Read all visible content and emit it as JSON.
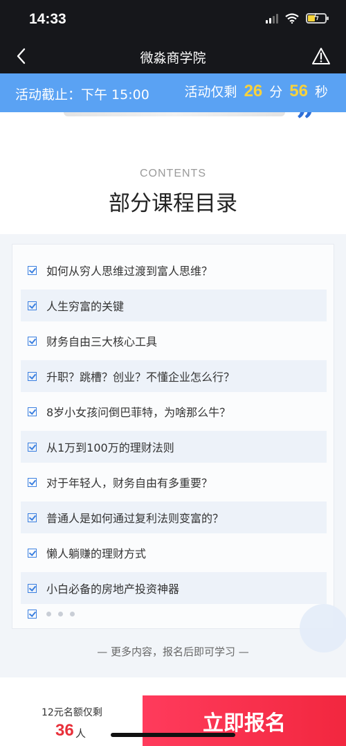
{
  "status_bar": {
    "time": "14:33"
  },
  "nav": {
    "title": "微淼商学院"
  },
  "countdown": {
    "deadline": "活动截止：下午 15:00",
    "remaining_label": "活动仅剩",
    "minutes": "26",
    "minutes_unit": "分",
    "seconds": "56",
    "seconds_unit": "秒"
  },
  "section": {
    "eyebrow": "CONTENTS",
    "title": "部分课程目录"
  },
  "course_items": [
    "如何从穷人思维过渡到富人思维？",
    "人生穷富的关键",
    "财务自由三大核心工具",
    "升职？跳槽？创业？不懂企业怎么行？",
    "8岁小女孩问倒巴菲特，为啥那么牛？",
    "从1万到100万的理财法则",
    "对于年轻人，财务自由有多重要？",
    "普通人是如何通过复利法则变富的？",
    "懒人躺赚的理财方式",
    "小白必备的房地产投资神器"
  ],
  "more_text": "— 更多内容，报名后即可学习 —",
  "bottom": {
    "slots_label": "12元名额仅剩",
    "slots_count": "36",
    "slots_unit": "人",
    "signup_label": "立即报名"
  },
  "colors": {
    "topbar": "#16171b",
    "countdown_bg": "#5aa2f3",
    "countdown_digits": "#f8d23c",
    "accent_blue": "#3a7fe0",
    "signup_red": "#f2273f"
  }
}
